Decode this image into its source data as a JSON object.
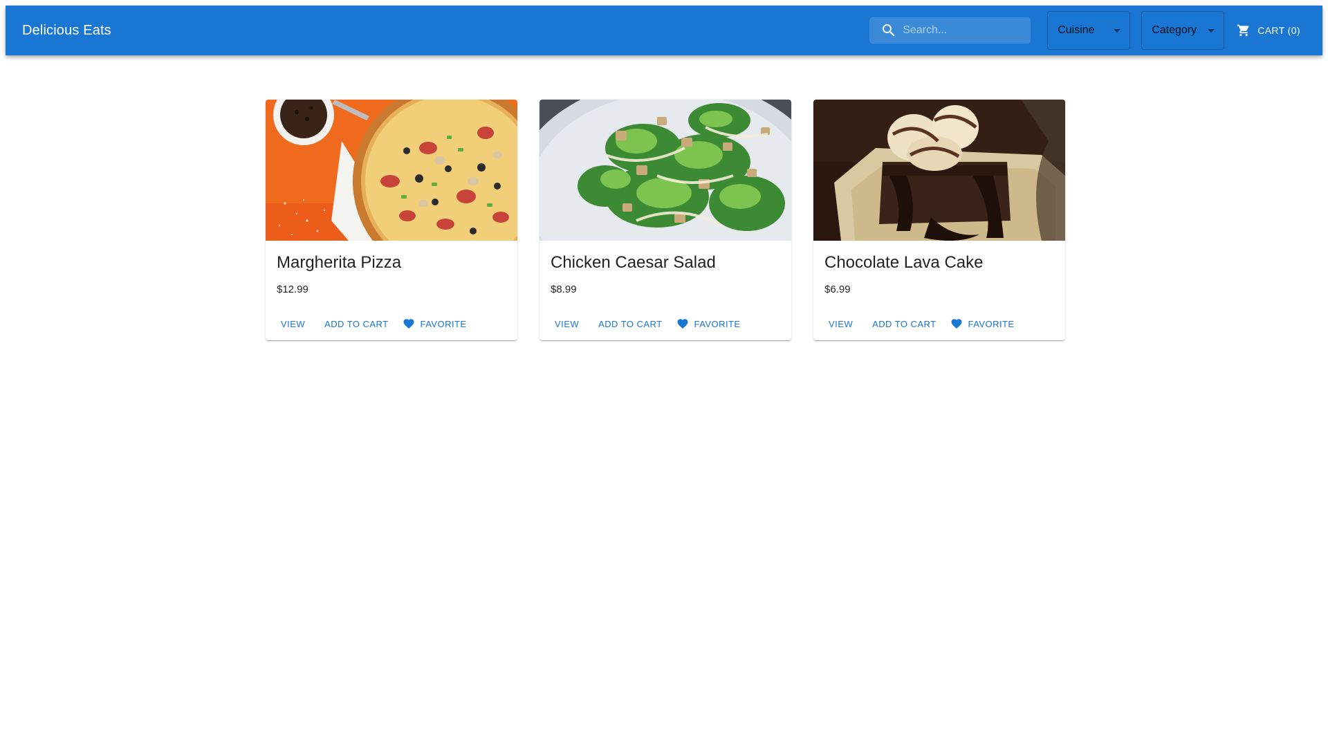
{
  "header": {
    "title": "Delicious Eats",
    "search_placeholder": "Search...",
    "cuisine_label": "Cuisine",
    "category_label": "Category",
    "cart_label": "Cart (0)"
  },
  "icons": {
    "search": "search-icon",
    "dropdown": "arrow-drop-down-icon",
    "cart": "shopping-cart-icon",
    "favorite": "heart-icon"
  },
  "colors": {
    "primary": "#1976d2",
    "background": "#ffffff"
  },
  "products": [
    {
      "name": "Margherita Pizza",
      "price": "$12.99",
      "view_label": "View",
      "add_label": "Add to Cart",
      "fav_label": "Favorite"
    },
    {
      "name": "Chicken Caesar Salad",
      "price": "$8.99",
      "view_label": "View",
      "add_label": "Add to Cart",
      "fav_label": "Favorite"
    },
    {
      "name": "Chocolate Lava Cake",
      "price": "$6.99",
      "view_label": "View",
      "add_label": "Add to Cart",
      "fav_label": "Favorite"
    }
  ]
}
